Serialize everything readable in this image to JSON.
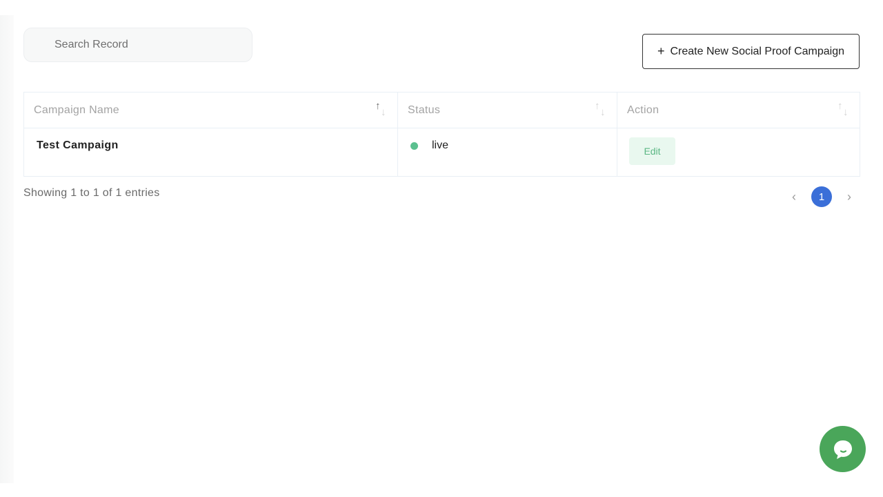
{
  "search": {
    "placeholder": "Search Record",
    "value": ""
  },
  "toolbar": {
    "create_icon": "plus-icon",
    "create_label": "Create New Social Proof Campaign"
  },
  "table": {
    "columns": [
      {
        "label": "Campaign Name",
        "sort_icon": "sort-icon",
        "sort_state": "ascending"
      },
      {
        "label": "Status",
        "sort_icon": "sort-icon",
        "sort_state": "none"
      },
      {
        "label": "Action",
        "sort_icon": "sort-icon",
        "sort_state": "none"
      }
    ],
    "rows": [
      {
        "campaign_name": "Test Campaign",
        "status": "live",
        "status_color": "#5bc08f",
        "action_label": "Edit"
      }
    ]
  },
  "footer": {
    "showing_text": "Showing 1 to 1 of 1 entries"
  },
  "pagination": {
    "prev_icon": "chevron-left-icon",
    "current_page": "1",
    "next_icon": "chevron-right-icon",
    "active_color": "#3b6fd8"
  },
  "chat_widget": {
    "icon": "chat-bubble-icon",
    "color": "#4aa65a"
  }
}
